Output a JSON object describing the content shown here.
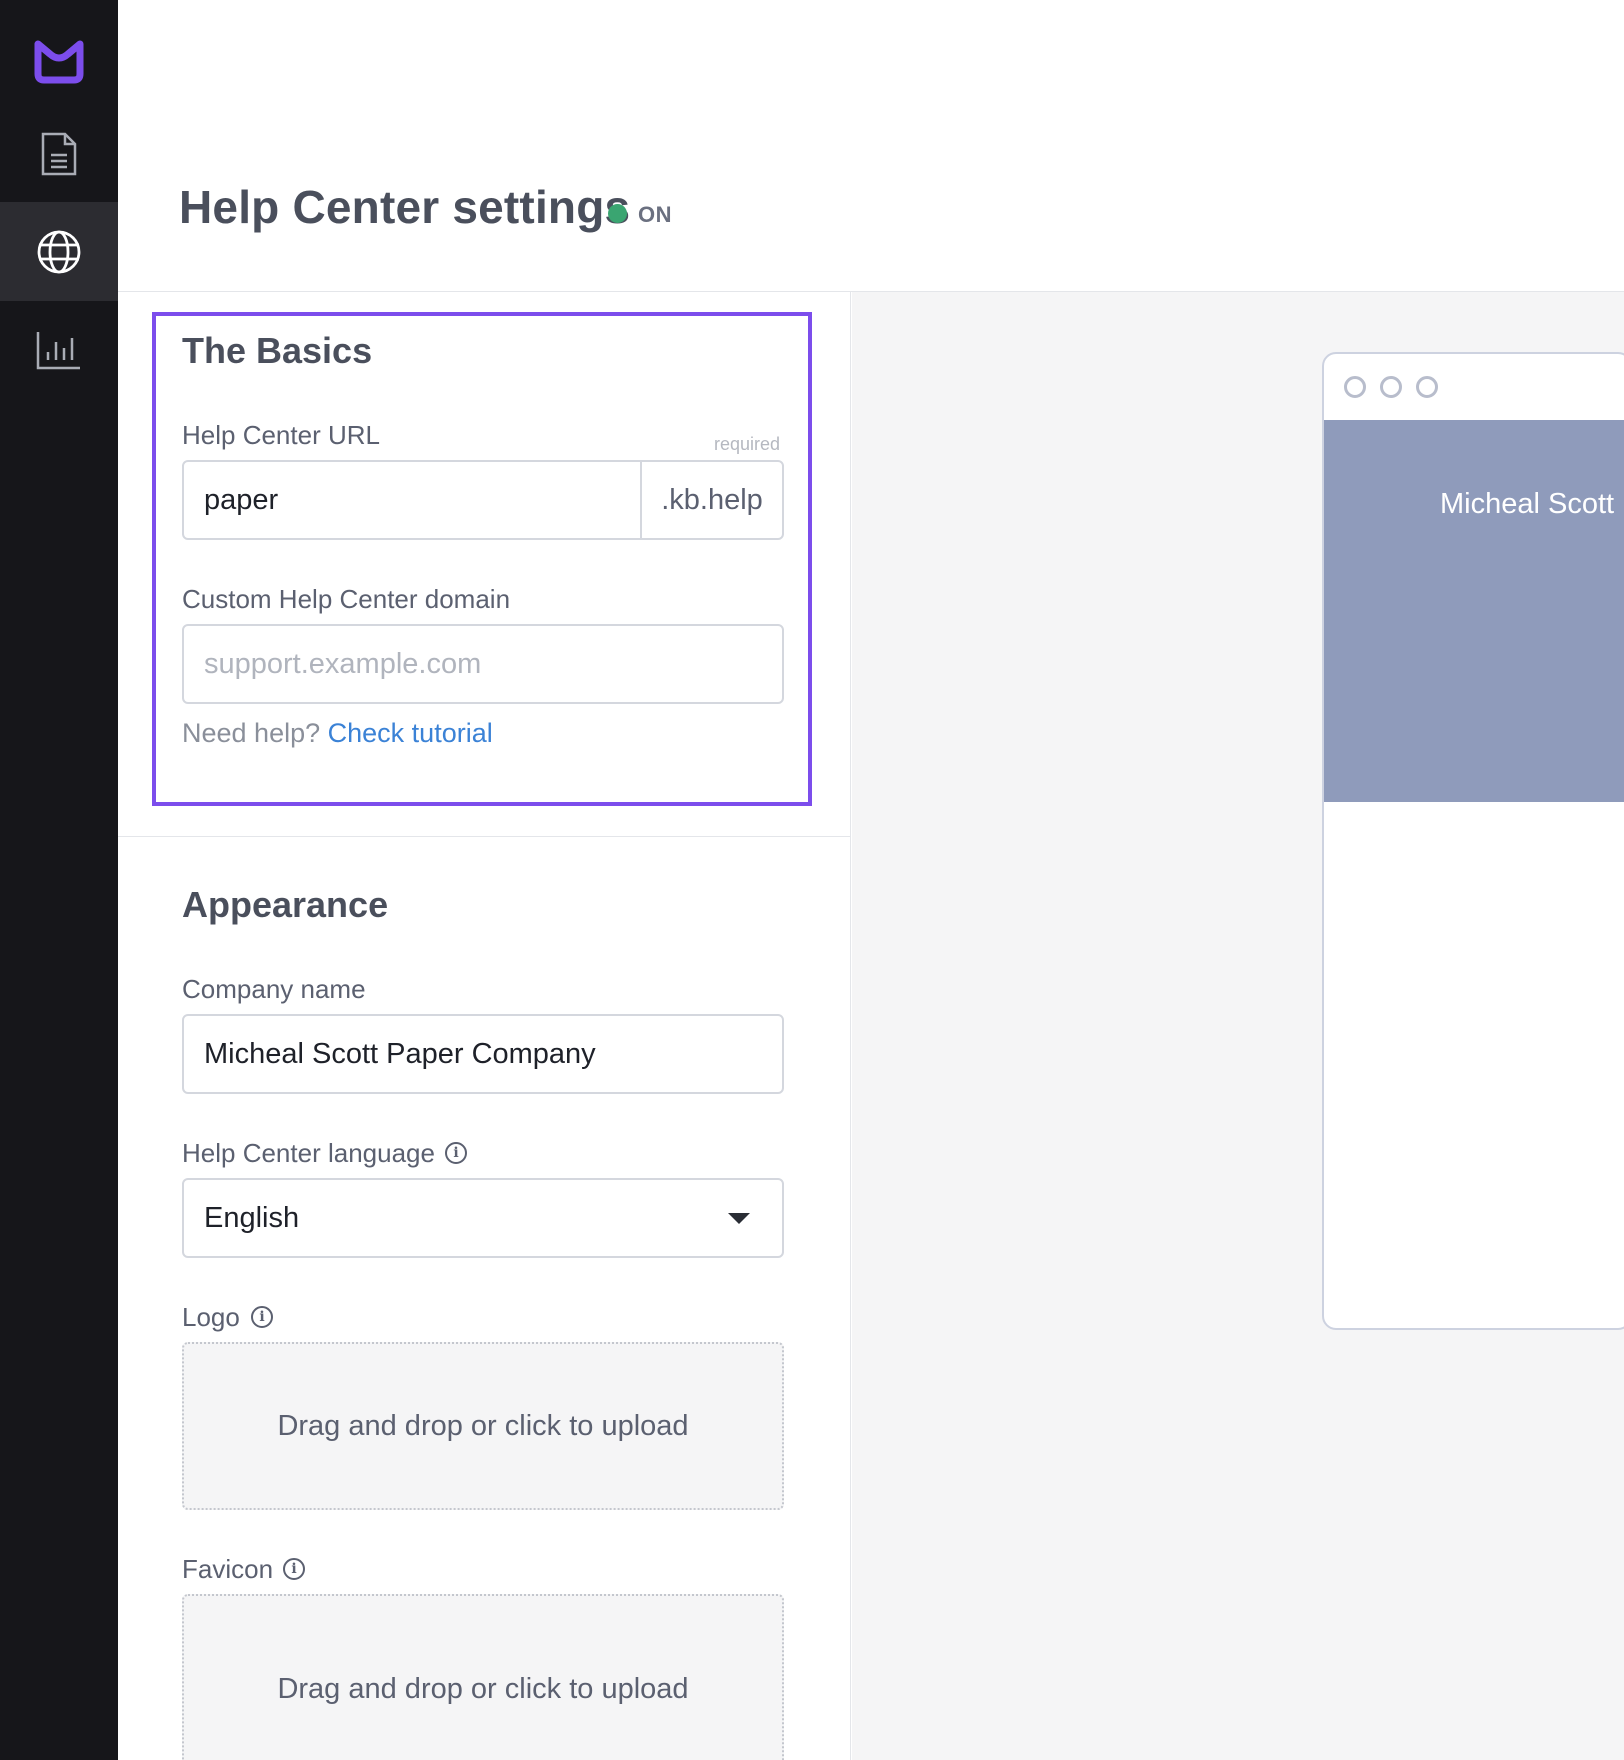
{
  "sidebar": {
    "items": [
      {
        "name": "logo",
        "icon": "brand-logo-icon"
      },
      {
        "name": "articles",
        "icon": "document-icon"
      },
      {
        "name": "help-center",
        "icon": "globe-icon",
        "active": true
      },
      {
        "name": "analytics",
        "icon": "bar-chart-icon"
      }
    ],
    "accent_color": "#7c4dec"
  },
  "header": {
    "title": "Help Center settings",
    "status": "ON",
    "status_color": "#3aa571"
  },
  "basics": {
    "heading": "The Basics",
    "url_label": "Help Center URL",
    "url_required": "required",
    "url_value": "paper",
    "url_suffix": ".kb.help",
    "domain_label": "Custom Help Center domain",
    "domain_placeholder": "support.example.com",
    "help_prefix": "Need help?",
    "help_link": "Check tutorial"
  },
  "appearance": {
    "heading": "Appearance",
    "company_label": "Company name",
    "company_value": "Micheal Scott Paper Company",
    "language_label": "Help Center language",
    "language_value": "English",
    "logo_label": "Logo",
    "logo_upload": "Drag and drop or click to upload",
    "favicon_label": "Favicon",
    "favicon_upload": "Drag and drop or click to upload"
  },
  "preview": {
    "banner_text": "Micheal Scott P",
    "banner_color": "#8f9bbb"
  }
}
